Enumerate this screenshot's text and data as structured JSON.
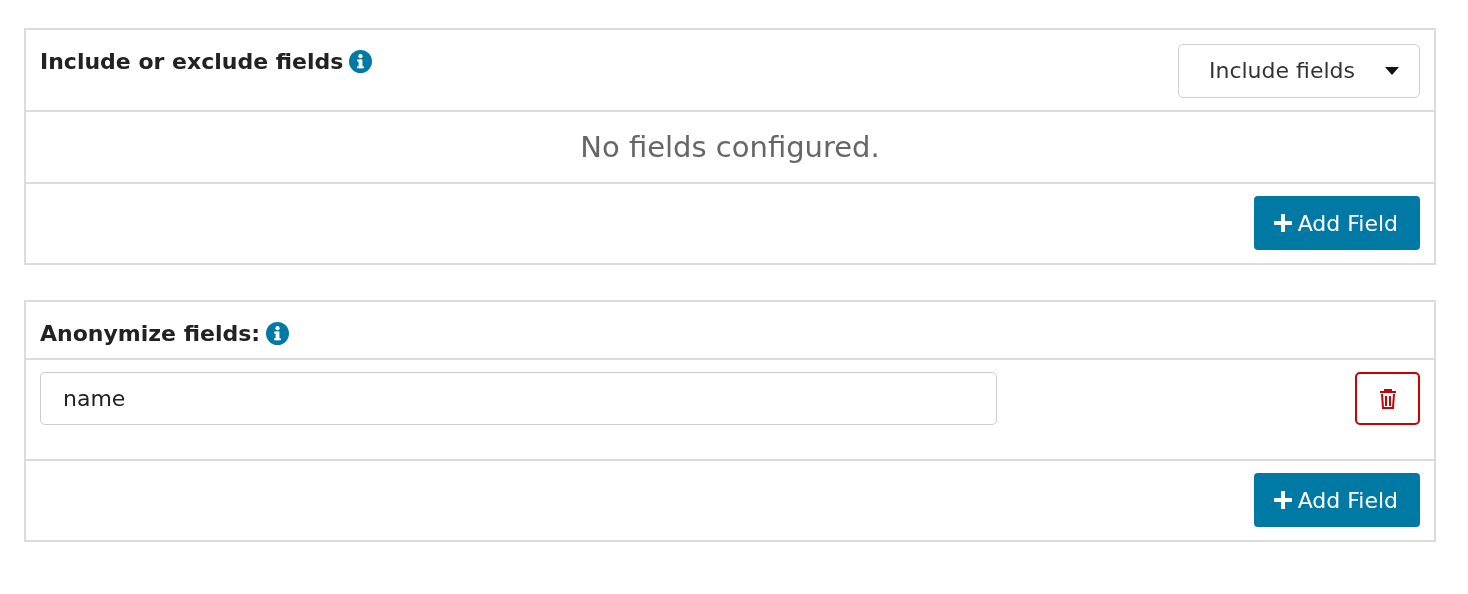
{
  "panels": [
    {
      "title": "Include or exclude fields",
      "mode_dropdown": {
        "value": "Include fields"
      },
      "empty_message": "No fields configured.",
      "add_button": "Add Field"
    },
    {
      "title": "Anonymize fields:",
      "fields": [
        {
          "value": "name"
        }
      ],
      "add_button": "Add Field"
    }
  ]
}
